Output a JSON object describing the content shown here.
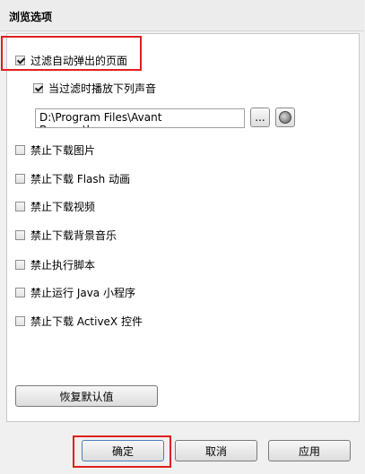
{
  "header": {
    "title": "浏览选项"
  },
  "options": {
    "filter_popups": {
      "label": "过滤自动弹出的页面",
      "checked": true
    },
    "play_sound": {
      "label": "当过滤时播放下列声音",
      "checked": true
    },
    "sound_path": "D:\\Program Files\\Avant Browser\\kpp.w",
    "browse_button": "...",
    "items": [
      {
        "label": "禁止下载图片",
        "checked": false
      },
      {
        "label": "禁止下载 Flash 动画",
        "checked": false
      },
      {
        "label": "禁止下载视频",
        "checked": false
      },
      {
        "label": "禁止下载背景音乐",
        "checked": false
      },
      {
        "label": "禁止执行脚本",
        "checked": false
      },
      {
        "label": "禁止运行 Java 小程序",
        "checked": false
      },
      {
        "label": "禁止下载 ActiveX 控件",
        "checked": false
      }
    ],
    "restore_defaults": "恢复默认值"
  },
  "footer": {
    "ok": "确定",
    "cancel": "取消",
    "apply": "应用"
  }
}
